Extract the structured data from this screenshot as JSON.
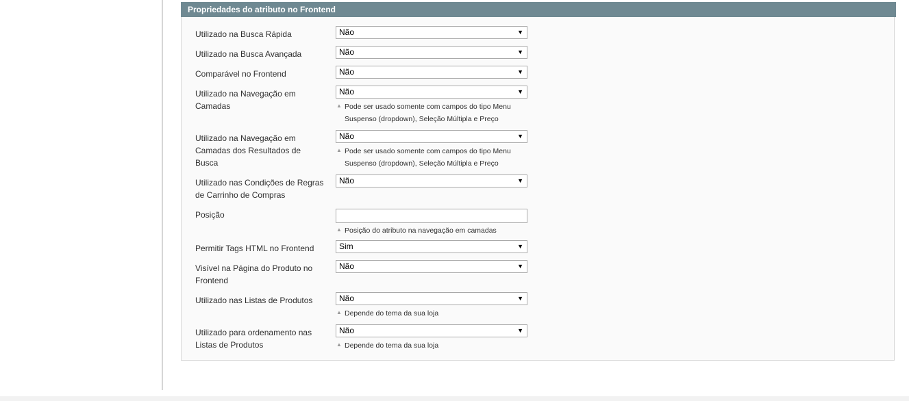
{
  "section": {
    "title": "Propriedades do atributo no Frontend"
  },
  "fields": {
    "quick_search": {
      "label": "Utilizado na Busca Rápida",
      "value": "Não"
    },
    "advanced_search": {
      "label": "Utilizado na Busca Avançada",
      "value": "Não"
    },
    "comparable": {
      "label": "Comparável no Frontend",
      "value": "Não"
    },
    "layered_nav": {
      "label": "Utilizado na Navegação em Camadas",
      "value": "Não",
      "note": "Pode ser usado somente com campos do tipo Menu Suspenso (dropdown), Seleção Múltipla e Preço"
    },
    "layered_nav_search": {
      "label": "Utilizado na Navegação em Camadas dos Resultados de Busca",
      "value": "Não",
      "note": "Pode ser usado somente com campos do tipo Menu Suspenso (dropdown), Seleção Múltipla e Preço"
    },
    "promo_rules": {
      "label": "Utilizado nas Condições de Regras de Carrinho de Compras",
      "value": "Não"
    },
    "position": {
      "label": "Posição",
      "value": "",
      "note": "Posição do atributo na navegação em camadas"
    },
    "html_tags": {
      "label": "Permitir Tags HTML no Frontend",
      "value": "Sim"
    },
    "visible_on_product": {
      "label": "Visível na Página do Produto no Frontend",
      "value": "Não"
    },
    "product_listing": {
      "label": "Utilizado nas Listas de Produtos",
      "value": "Não",
      "note": "Depende do tema da sua loja"
    },
    "sort_by": {
      "label": "Utilizado para ordenamento nas Listas de Produtos",
      "value": "Não",
      "note": "Depende do tema da sua loja"
    }
  },
  "icons": {
    "select_arrow": "▼",
    "note_marker": "▲"
  },
  "colors": {
    "header_bg": "#6f8992",
    "panel_bg": "#fafafa",
    "border": "#d6d6d6"
  }
}
